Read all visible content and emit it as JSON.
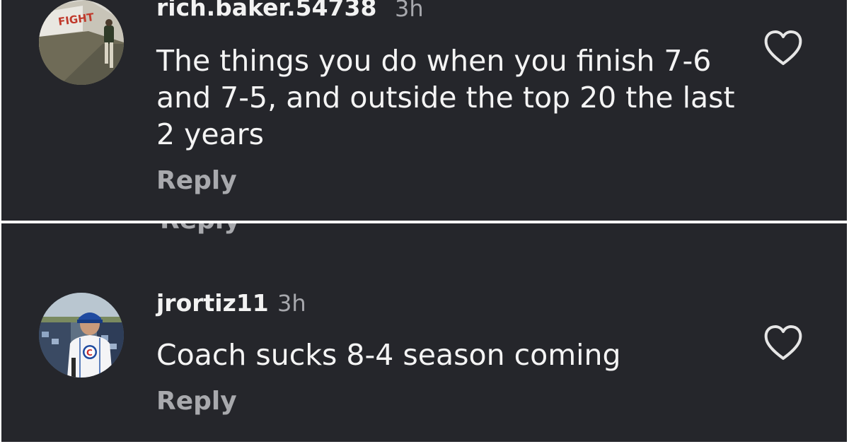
{
  "colors": {
    "background": "#25262b",
    "username": "#f2f2f2",
    "timestamp": "#a7a8ad",
    "text": "#f4f4f4",
    "reply": "#a8a9ad",
    "heart_outline": "#e6e6e6"
  },
  "comments": [
    {
      "username": "rich.baker.54738",
      "timestamp": "3h",
      "text": "The things you do when you finish 7-6 and 7-5, and outside the top 20 the last 2 years",
      "reply_label": "Reply",
      "avatar_sign_text": "FIGHT",
      "like_icon": "heart-outline-icon"
    },
    {
      "username": "jrortiz11",
      "timestamp": "3h",
      "text": "Coach sucks 8-4 season coming",
      "reply_label": "Reply",
      "avatar_jersey_logo": "C",
      "like_icon": "heart-outline-icon"
    }
  ],
  "cut_off_reply_label": "Reply"
}
